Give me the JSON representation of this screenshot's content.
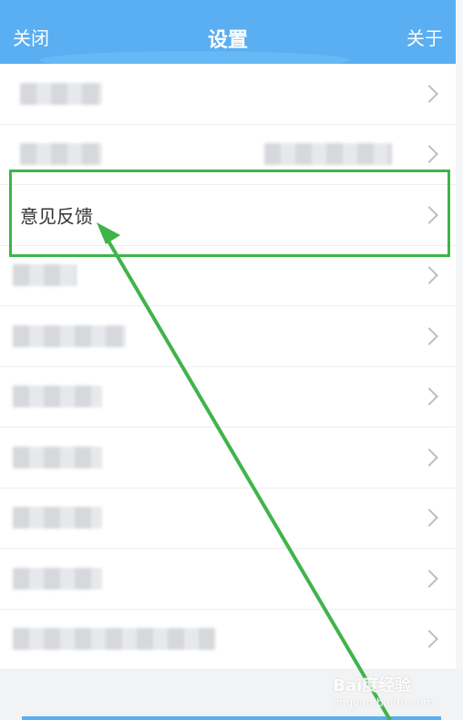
{
  "header": {
    "left_label": "关闭",
    "title": "设置",
    "right_label": "关于"
  },
  "list": {
    "feedback_label": "意见反馈"
  },
  "watermark": {
    "brand": "Bai度经验",
    "url": "jingyan.baidu.com"
  },
  "colors": {
    "header_bg": "#5aaef2",
    "highlight": "#3fb44a",
    "arrow": "#3fb44a"
  },
  "icons": {
    "chevron": "chevron-right-icon"
  }
}
